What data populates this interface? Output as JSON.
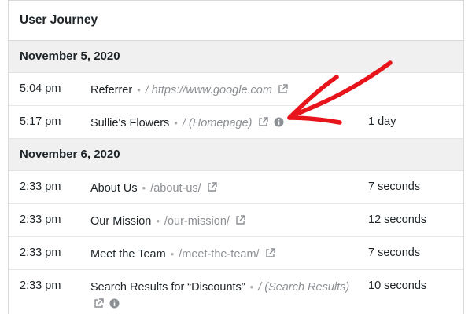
{
  "card": {
    "title": "User Journey"
  },
  "groups": [
    {
      "date": "November 5, 2020",
      "rows": [
        {
          "time": "5:04 pm",
          "title": "Referrer",
          "separator": "•",
          "url": "/ https://www.google.com",
          "url_italic": true,
          "duration": ""
        },
        {
          "time": "5:17 pm",
          "title": "Sullie's Flowers",
          "separator": "•",
          "url": "/ (Homepage)",
          "url_italic": true,
          "duration": "1 day"
        }
      ]
    },
    {
      "date": "November 6, 2020",
      "rows": [
        {
          "time": "2:33 pm",
          "title": "About Us",
          "separator": "•",
          "url": "/about-us/",
          "url_italic": false,
          "duration": "7 seconds"
        },
        {
          "time": "2:33 pm",
          "title": "Our Mission",
          "separator": "•",
          "url": "/our-mission/",
          "url_italic": false,
          "duration": "12 seconds"
        },
        {
          "time": "2:33 pm",
          "title": "Meet the Team",
          "separator": "•",
          "url": "/meet-the-team/",
          "url_italic": false,
          "duration": "7 seconds"
        },
        {
          "time": "2:33 pm",
          "title": "Search Results for “Discounts”",
          "separator": "•",
          "url": "/ (Search Results)",
          "url_italic": true,
          "duration": "10 seconds"
        }
      ]
    }
  ],
  "icons": {
    "external_link": "external-link-icon",
    "info": "info-icon",
    "annotation": "red-arrow-annotation"
  },
  "colors": {
    "header_bg": "#f0f0f1",
    "muted_text": "#8c8f94",
    "icon_gray": "#8c8f94",
    "annotation_red": "#e8141c"
  }
}
